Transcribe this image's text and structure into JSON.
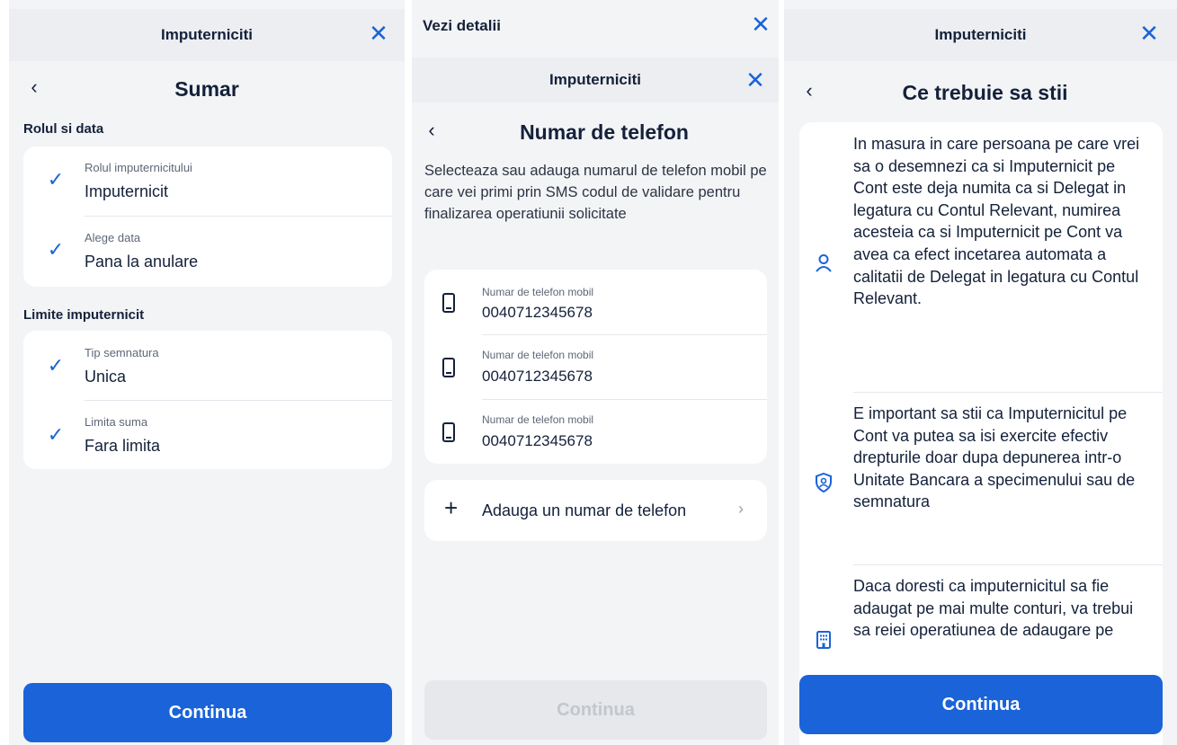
{
  "panel1": {
    "topbar_title": "Imputerniciti",
    "title": "Sumar",
    "section1_label": "Rolul si data",
    "section1_rows": [
      {
        "label": "Rolul imputernicitului",
        "value": "Imputernicit"
      },
      {
        "label": "Alege data",
        "value": "Pana la anulare"
      }
    ],
    "section2_label": "Limite imputernicit",
    "section2_rows": [
      {
        "label": "Tip semnatura",
        "value": "Unica"
      },
      {
        "label": "Limita suma",
        "value": "Fara limita"
      }
    ],
    "continue_label": "Continua"
  },
  "panel2": {
    "outer_title": "Vezi detalii",
    "topbar_title": "Imputerniciti",
    "title": "Numar de telefon",
    "description": "Selecteaza sau adauga numarul de telefon mobil pe care vei primi prin SMS codul de validare pentru finalizarea operatiunii solicitate",
    "phones": [
      {
        "label": "Numar de telefon mobil",
        "number": "0040712345678"
      },
      {
        "label": "Numar de telefon mobil",
        "number": "0040712345678"
      },
      {
        "label": "Numar de telefon mobil",
        "number": "0040712345678"
      }
    ],
    "add_label": "Adauga un numar de telefon",
    "continue_label": "Continua"
  },
  "panel3": {
    "topbar_title": "Imputerniciti",
    "title": "Ce trebuie sa stii",
    "items": [
      {
        "icon": "person-icon",
        "text": "In masura in care persoana pe care vrei sa o desemnezi ca si Imputernicit pe Cont este deja numita ca si Delegat in legatura cu Contul Relevant, numirea acesteia ca si Imputernicit pe Cont va avea ca efect incetarea automata a calitatii de Delegat in legatura cu Contul Relevant."
      },
      {
        "icon": "shield-user-icon",
        "text": "E important sa stii ca Imputernicitul pe Cont va putea sa isi exercite efectiv drepturile doar dupa depunerea intr-o Unitate Bancara a specimenului sau de semnatura"
      },
      {
        "icon": "building-icon",
        "text": "Daca doresti ca imputernicitul sa fie adaugat pe mai multe conturi, va trebui sa reiei operatiunea de adaugare pe"
      }
    ],
    "continue_label": "Continua"
  },
  "colors": {
    "accent": "#1a63d8",
    "text": "#14213a",
    "background": "#f3f4f6"
  }
}
